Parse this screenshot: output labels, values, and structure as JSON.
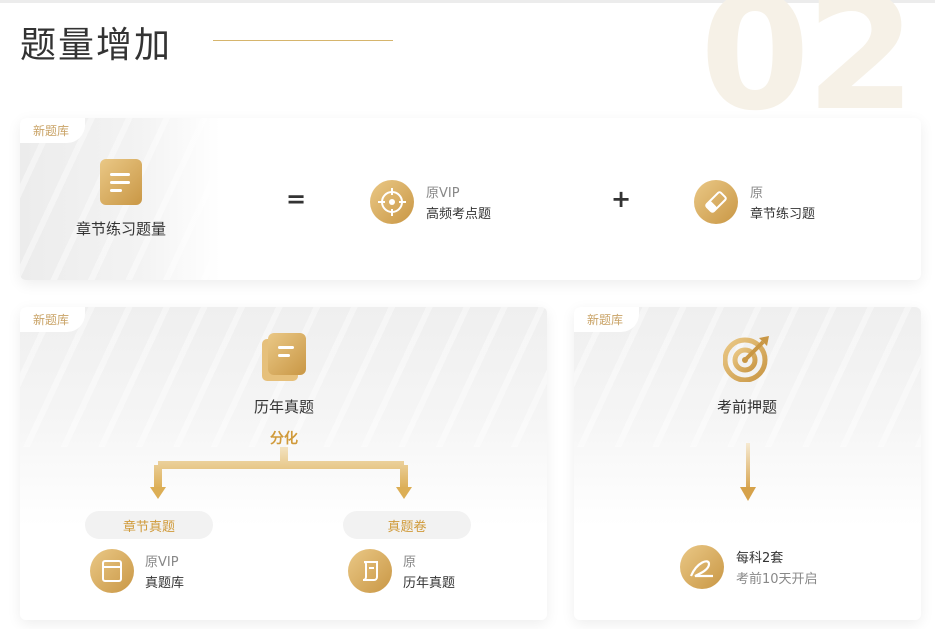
{
  "header": {
    "title": "题量增加",
    "section_number": "02"
  },
  "card1": {
    "tag": "新题库",
    "result_label": "章节练习题量",
    "equals": "=",
    "plus": "+",
    "item1": {
      "line1": "原VIP",
      "line2": "高频考点题"
    },
    "item2": {
      "line1": "原",
      "line2": "章节练习题"
    }
  },
  "card2": {
    "tag": "新题库",
    "source_label": "历年真题",
    "split_label": "分化",
    "left": {
      "pill": "章节真题",
      "line1": "原VIP",
      "line2": "真题库"
    },
    "right": {
      "pill": "真题卷",
      "line1": "原",
      "line2": "历年真题"
    }
  },
  "card3": {
    "tag": "新题库",
    "label": "考前押题",
    "info_line1": "每科2套",
    "info_line2": "考前10天开启"
  },
  "colors": {
    "gold": "#d09a3a",
    "gold_light": "#eac886",
    "gold_dark": "#c99745"
  },
  "icons": [
    "document-icon",
    "target-icon",
    "eraser-icon",
    "book-icon",
    "bullseye-icon",
    "scroll-icon",
    "pen-icon",
    "arrow-down-icon",
    "split-arrow-icon"
  ]
}
